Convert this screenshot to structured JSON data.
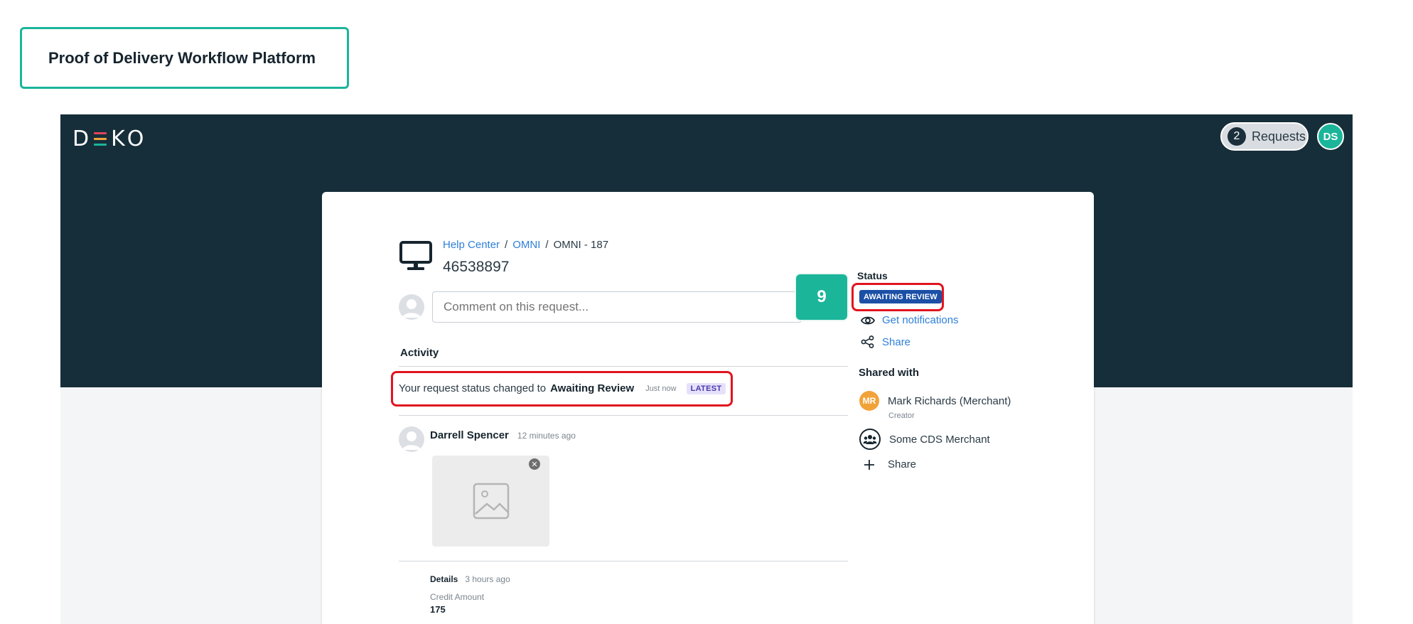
{
  "page_label": "Proof of Delivery Workflow Platform",
  "header": {
    "logo_text": [
      "D",
      "K",
      "O"
    ],
    "logo_bar_colors": [
      "#e2445c",
      "#f1a33a",
      "#1bb59a"
    ],
    "requests_count": "2",
    "requests_label": "Requests",
    "user_initials": "DS"
  },
  "request": {
    "icon": "monitor-icon",
    "breadcrumb": [
      "Help Center",
      "OMNI",
      "OMNI - 187"
    ],
    "breadcrumb_sep": "/",
    "id": "46538897",
    "comment_placeholder": "Comment on this request...",
    "step_badge": "9"
  },
  "activity": {
    "heading": "Activity",
    "status_change": {
      "prefix": "Your request status changed to",
      "status": "Awaiting Review",
      "time": "Just now",
      "tag": "LATEST"
    },
    "comment": {
      "author": "Darrell Spencer",
      "time": "12 minutes ago",
      "attachment_icon": "image-placeholder-icon"
    },
    "details": {
      "label": "Details",
      "time": "3 hours ago",
      "field_label": "Credit Amount",
      "field_value": "175"
    }
  },
  "sidebar": {
    "status_heading": "Status",
    "status_value": "AWAITING REVIEW",
    "notifications_label": "Get notifications",
    "share_label": "Share",
    "shared_with_heading": "Shared with",
    "shared": [
      {
        "initials": "MR",
        "name": "Mark Richards (Merchant)",
        "role": "Creator"
      },
      {
        "name": "Some CDS Merchant"
      }
    ],
    "add_share_label": "Share"
  },
  "colors": {
    "accent": "#1bb59a",
    "header_bg": "#162e39",
    "link": "#2e7fd9",
    "highlight": "#e1141e",
    "status_badge": "#1b50a6"
  }
}
